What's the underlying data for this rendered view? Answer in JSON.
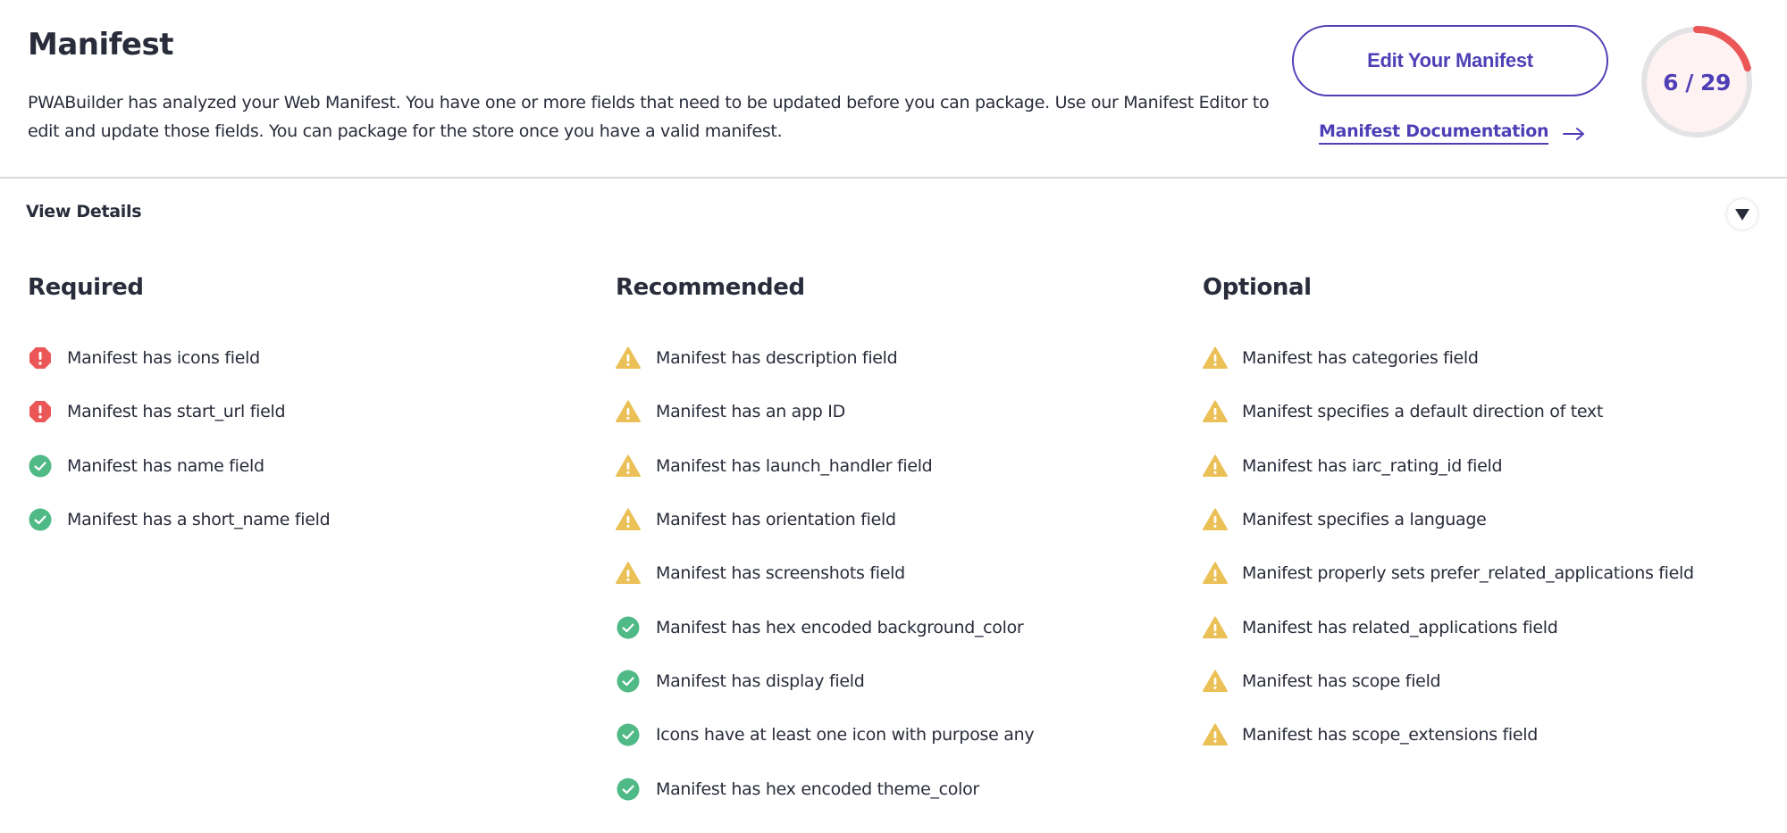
{
  "header": {
    "title": "Manifest",
    "description": "PWABuilder has analyzed your Web Manifest. You have one or more fields that need to be updated before you can package. Use our Manifest Editor to edit and update those fields. You can package for the store once you have a valid manifest.",
    "edit_button_label": "Edit Your Manifest",
    "doc_link_label": "Manifest Documentation",
    "doc_link_icon": "arrow-right-icon"
  },
  "score": {
    "passed": 6,
    "total": 29,
    "label": "6 / 29",
    "progress_color": "#eb5757",
    "track_color": "#e3e3e6",
    "fill_color": "#fff2f2"
  },
  "details": {
    "label": "View Details",
    "toggle_icon": "caret-down-icon",
    "expanded": true
  },
  "colors": {
    "accent": "#4f3fb6",
    "error": "#eb5757",
    "warning": "#ebc157",
    "success": "#50ba87"
  },
  "columns": [
    {
      "heading": "Required",
      "items": [
        {
          "status": "error",
          "icon": "error-octagon-icon",
          "text": "Manifest has icons field"
        },
        {
          "status": "error",
          "icon": "error-octagon-icon",
          "text": "Manifest has start_url field"
        },
        {
          "status": "pass",
          "icon": "check-circle-icon",
          "text": "Manifest has name field"
        },
        {
          "status": "pass",
          "icon": "check-circle-icon",
          "text": "Manifest has a short_name field"
        }
      ]
    },
    {
      "heading": "Recommended",
      "items": [
        {
          "status": "warning",
          "icon": "warning-triangle-icon",
          "text": "Manifest has description field"
        },
        {
          "status": "warning",
          "icon": "warning-triangle-icon",
          "text": "Manifest has an app ID"
        },
        {
          "status": "warning",
          "icon": "warning-triangle-icon",
          "text": "Manifest has launch_handler field"
        },
        {
          "status": "warning",
          "icon": "warning-triangle-icon",
          "text": "Manifest has orientation field"
        },
        {
          "status": "warning",
          "icon": "warning-triangle-icon",
          "text": "Manifest has screenshots field"
        },
        {
          "status": "pass",
          "icon": "check-circle-icon",
          "text": "Manifest has hex encoded background_color"
        },
        {
          "status": "pass",
          "icon": "check-circle-icon",
          "text": "Manifest has display field"
        },
        {
          "status": "pass",
          "icon": "check-circle-icon",
          "text": "Icons have at least one icon with purpose any"
        },
        {
          "status": "pass",
          "icon": "check-circle-icon",
          "text": "Manifest has hex encoded theme_color"
        }
      ]
    },
    {
      "heading": "Optional",
      "items": [
        {
          "status": "warning",
          "icon": "warning-triangle-icon",
          "text": "Manifest has categories field"
        },
        {
          "status": "warning",
          "icon": "warning-triangle-icon",
          "text": "Manifest specifies a default direction of text"
        },
        {
          "status": "warning",
          "icon": "warning-triangle-icon",
          "text": "Manifest has iarc_rating_id field"
        },
        {
          "status": "warning",
          "icon": "warning-triangle-icon",
          "text": "Manifest specifies a language"
        },
        {
          "status": "warning",
          "icon": "warning-triangle-icon",
          "text": "Manifest properly sets prefer_related_applications field"
        },
        {
          "status": "warning",
          "icon": "warning-triangle-icon",
          "text": "Manifest has related_applications field"
        },
        {
          "status": "warning",
          "icon": "warning-triangle-icon",
          "text": "Manifest has scope field"
        },
        {
          "status": "warning",
          "icon": "warning-triangle-icon",
          "text": "Manifest has scope_extensions field"
        }
      ]
    }
  ]
}
